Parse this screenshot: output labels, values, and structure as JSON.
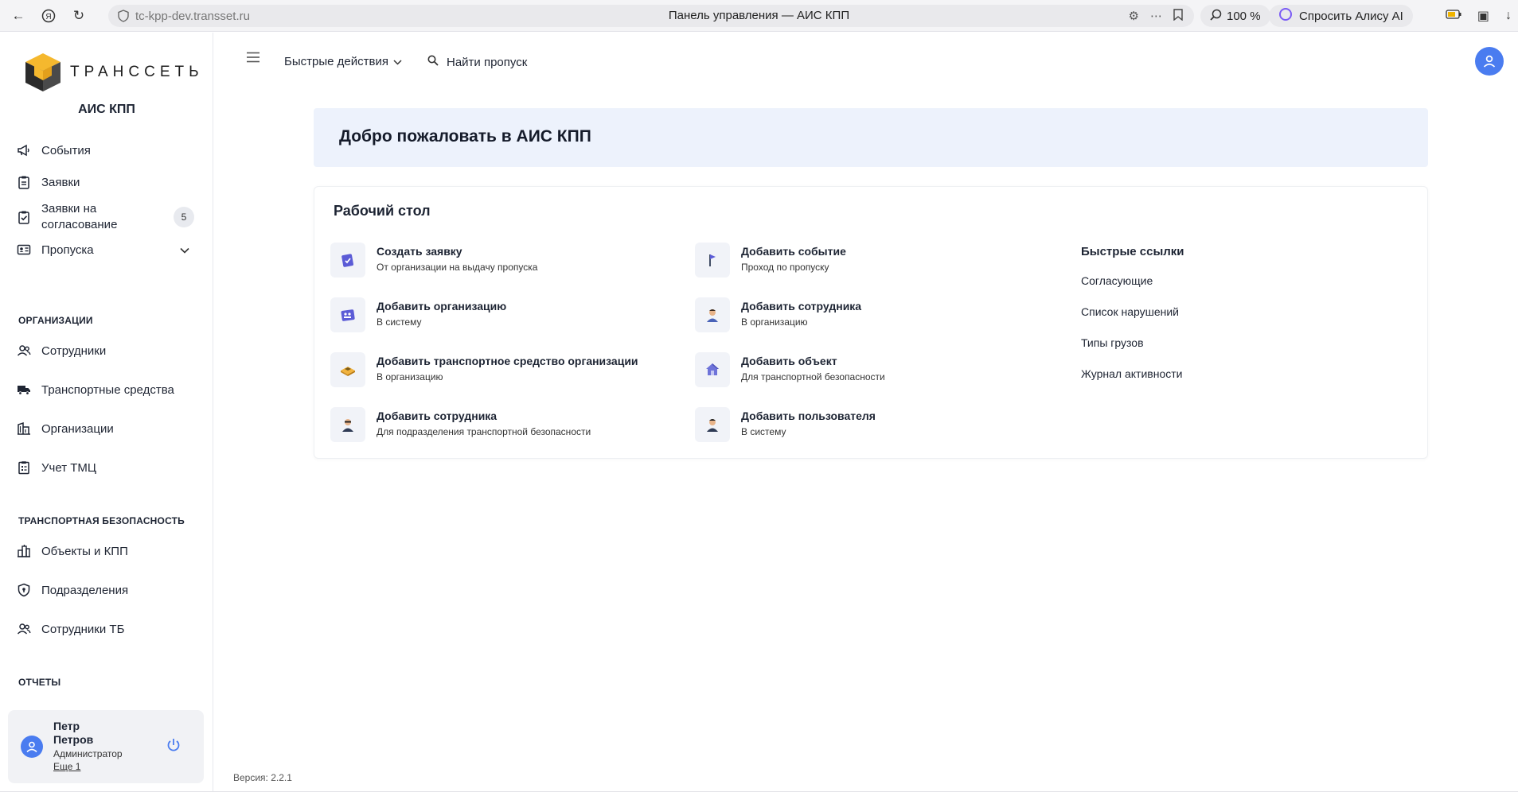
{
  "browser": {
    "url": "tc-kpp-dev.transset.ru",
    "title": "Панель управления — АИС КПП",
    "zoom": "100 %",
    "alice": "Спросить Алису AI"
  },
  "brand": {
    "logo_text": "ТРАНССЕТЬ",
    "app_name": "АИС КПП",
    "accent": "#4a7cf0"
  },
  "sidebar": {
    "top_items": [
      {
        "label": "События",
        "icon": "megaphone-icon"
      },
      {
        "label": "Заявки",
        "icon": "clipboard-icon"
      },
      {
        "label": "Заявки на согласование",
        "icon": "clipboard-check-icon",
        "badge": "5"
      },
      {
        "label": "Пропуска",
        "icon": "id-card-icon"
      }
    ],
    "sections": [
      {
        "title": "ОРГАНИЗАЦИИ",
        "items": [
          {
            "label": "Сотрудники",
            "icon": "people-icon"
          },
          {
            "label": "Транспортные средства",
            "icon": "truck-icon"
          },
          {
            "label": "Организации",
            "icon": "building-icon"
          },
          {
            "label": "Учет ТМЦ",
            "icon": "inventory-icon"
          }
        ]
      },
      {
        "title": "ТРАНСПОРТНАЯ БЕЗОПАСНОСТЬ",
        "items": [
          {
            "label": "Объекты и КПП",
            "icon": "city-icon"
          },
          {
            "label": "Подразделения",
            "icon": "shield-icon"
          },
          {
            "label": "Сотрудники ТБ",
            "icon": "people-icon"
          }
        ]
      },
      {
        "title": "ОТЧЕТЫ",
        "items": []
      }
    ]
  },
  "user": {
    "first_name": "Петр",
    "last_name": "Петров",
    "role": "Администратор",
    "more": "Еще 1"
  },
  "topbar": {
    "quick_actions": "Быстрые действия",
    "search_pass": "Найти пропуск"
  },
  "welcome": "Добро пожаловать в АИС КПП",
  "desk": {
    "title": "Рабочий стол",
    "actions": [
      {
        "title": "Создать заявку",
        "sub": "От организации на выдачу пропуска",
        "icon": "request-icon"
      },
      {
        "title": "Добавить событие",
        "sub": "Проход по пропуску",
        "icon": "flag-icon"
      },
      {
        "title": "Добавить организацию",
        "sub": "В систему",
        "icon": "organization-icon"
      },
      {
        "title": "Добавить сотрудника",
        "sub": "В организацию",
        "icon": "employee-icon"
      },
      {
        "title": "Добавить транспортное средство организации",
        "sub": "В организацию",
        "icon": "vehicle-icon"
      },
      {
        "title": "Добавить объект",
        "sub": "Для транспортной безопасности",
        "icon": "house-icon"
      },
      {
        "title": "Добавить сотрудника",
        "sub": "Для подразделения транспортной безопасности",
        "icon": "security-employee-icon"
      },
      {
        "title": "Добавить пользователя",
        "sub": "В систему",
        "icon": "user-icon"
      }
    ],
    "quick_links_title": "Быстрые ссылки",
    "quick_links": [
      "Согласующие",
      "Список нарушений",
      "Типы грузов",
      "Журнал активности"
    ]
  },
  "version": "Версия: 2.2.1"
}
